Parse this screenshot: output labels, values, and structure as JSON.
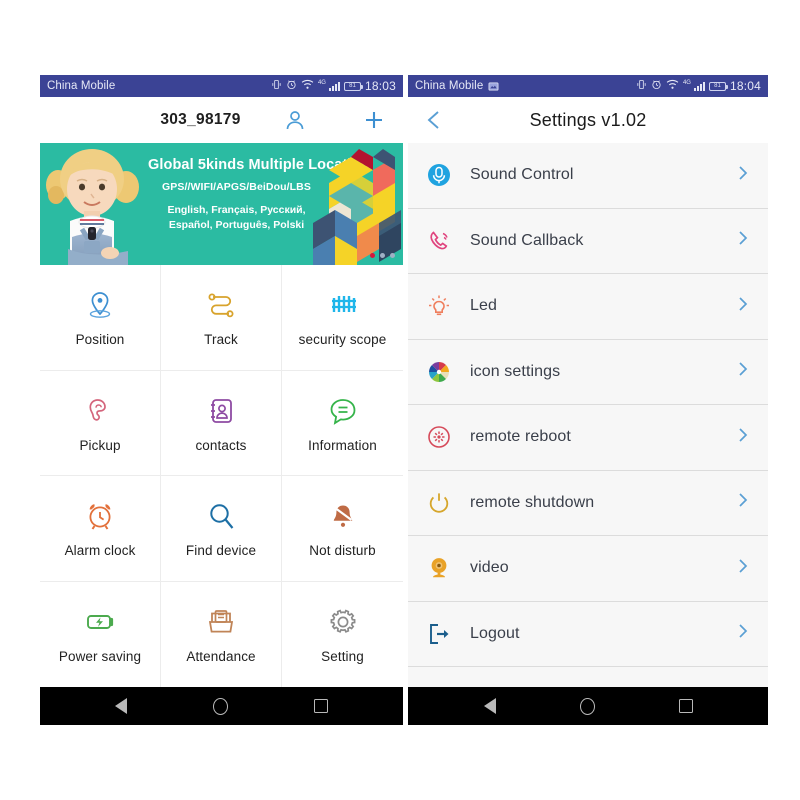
{
  "left_phone": {
    "status_bar": {
      "carrier": "China Mobile",
      "network": "4G",
      "battery": "81",
      "clock": "18:03",
      "icons": [
        "vibrate-icon",
        "alarm-icon",
        "wifi-icon",
        "signal-icon",
        "battery-icon"
      ]
    },
    "header": {
      "device_id": "303_98179",
      "profile_icon": "person-icon",
      "add_icon": "plus-icon"
    },
    "banner": {
      "headline": "Global 5kinds Multiple Location",
      "subline": "GPS//WIFI/APGS/BeiDou/LBS",
      "languages_line1": "English, Français, Русский,",
      "languages_line2": "Español, Português, Polski",
      "bg_color": "#2bbba2",
      "carousel_dots": 3,
      "carousel_active": 1,
      "active_dot_color": "#d6183c"
    },
    "grid": [
      {
        "label": "Position",
        "icon": "map-pin-icon",
        "color": "#3d8fd1"
      },
      {
        "label": "Track",
        "icon": "route-icon",
        "color": "#d8a32c"
      },
      {
        "label": "security scope",
        "icon": "fence-icon",
        "color": "#1fb6ea"
      },
      {
        "label": "Pickup",
        "icon": "ear-icon",
        "color": "#d4657c"
      },
      {
        "label": "contacts",
        "icon": "contact-book-icon",
        "color": "#8e4ba3"
      },
      {
        "label": "Information",
        "icon": "chat-bubble-icon",
        "color": "#35b44a"
      },
      {
        "label": "Alarm clock",
        "icon": "alarm-clock-icon",
        "color": "#e2703a"
      },
      {
        "label": "Find device",
        "icon": "magnifier-icon",
        "color": "#1d6fa5"
      },
      {
        "label": "Not disturb",
        "icon": "bell-muted-icon",
        "color": "#bf6b45"
      },
      {
        "label": "Power saving",
        "icon": "battery-bolt-icon",
        "color": "#4caa4e"
      },
      {
        "label": "Attendance",
        "icon": "card-punch-icon",
        "color": "#c08457"
      },
      {
        "label": "Setting",
        "icon": "gear-icon",
        "color": "#8b8b8b"
      }
    ],
    "nav_bar": {
      "back": "nav-back-icon",
      "home": "nav-home-icon",
      "recents": "nav-recents-icon"
    }
  },
  "right_phone": {
    "status_bar": {
      "carrier": "China Mobile",
      "network": "4G",
      "battery": "81",
      "clock": "18:04",
      "icons": [
        "screenshot-icon",
        "vibrate-icon",
        "alarm-icon",
        "wifi-icon",
        "signal-icon",
        "battery-icon"
      ]
    },
    "header": {
      "title": "Settings v1.02",
      "back_icon": "chevron-left-icon"
    },
    "settings_rows": [
      {
        "label": "Sound Control",
        "icon": "microphone-circle-icon",
        "color": "#1fa3e0",
        "chevron": "chevron-right-icon"
      },
      {
        "label": "Sound Callback",
        "icon": "phone-ring-icon",
        "color": "#e0447e",
        "chevron": "chevron-right-icon"
      },
      {
        "label": "Led",
        "icon": "lightbulb-icon",
        "color": "#ef7f5e",
        "chevron": "chevron-right-icon"
      },
      {
        "label": "icon settings",
        "icon": "color-pinwheel-icon",
        "color": "#d63b4a",
        "chevron": "chevron-right-icon"
      },
      {
        "label": "remote reboot",
        "icon": "reboot-circle-icon",
        "color": "#d64a5a",
        "chevron": "chevron-right-icon"
      },
      {
        "label": "remote shutdown",
        "icon": "power-icon",
        "color": "#d6a62c",
        "chevron": "chevron-right-icon"
      },
      {
        "label": "video",
        "icon": "webcam-icon",
        "color": "#e9a227",
        "chevron": "chevron-right-icon"
      },
      {
        "label": "Logout",
        "icon": "logout-arrow-icon",
        "color": "#1b5e8c",
        "chevron": "chevron-right-icon"
      }
    ],
    "nav_bar": {
      "back": "nav-back-icon",
      "home": "nav-home-icon",
      "recents": "nav-recents-icon"
    }
  },
  "theme": {
    "status_bar_color": "#3b4395",
    "accent_blue": "#3d8fd1",
    "list_bg": "#f7f7f7",
    "nav_bar_color": "#000000"
  }
}
